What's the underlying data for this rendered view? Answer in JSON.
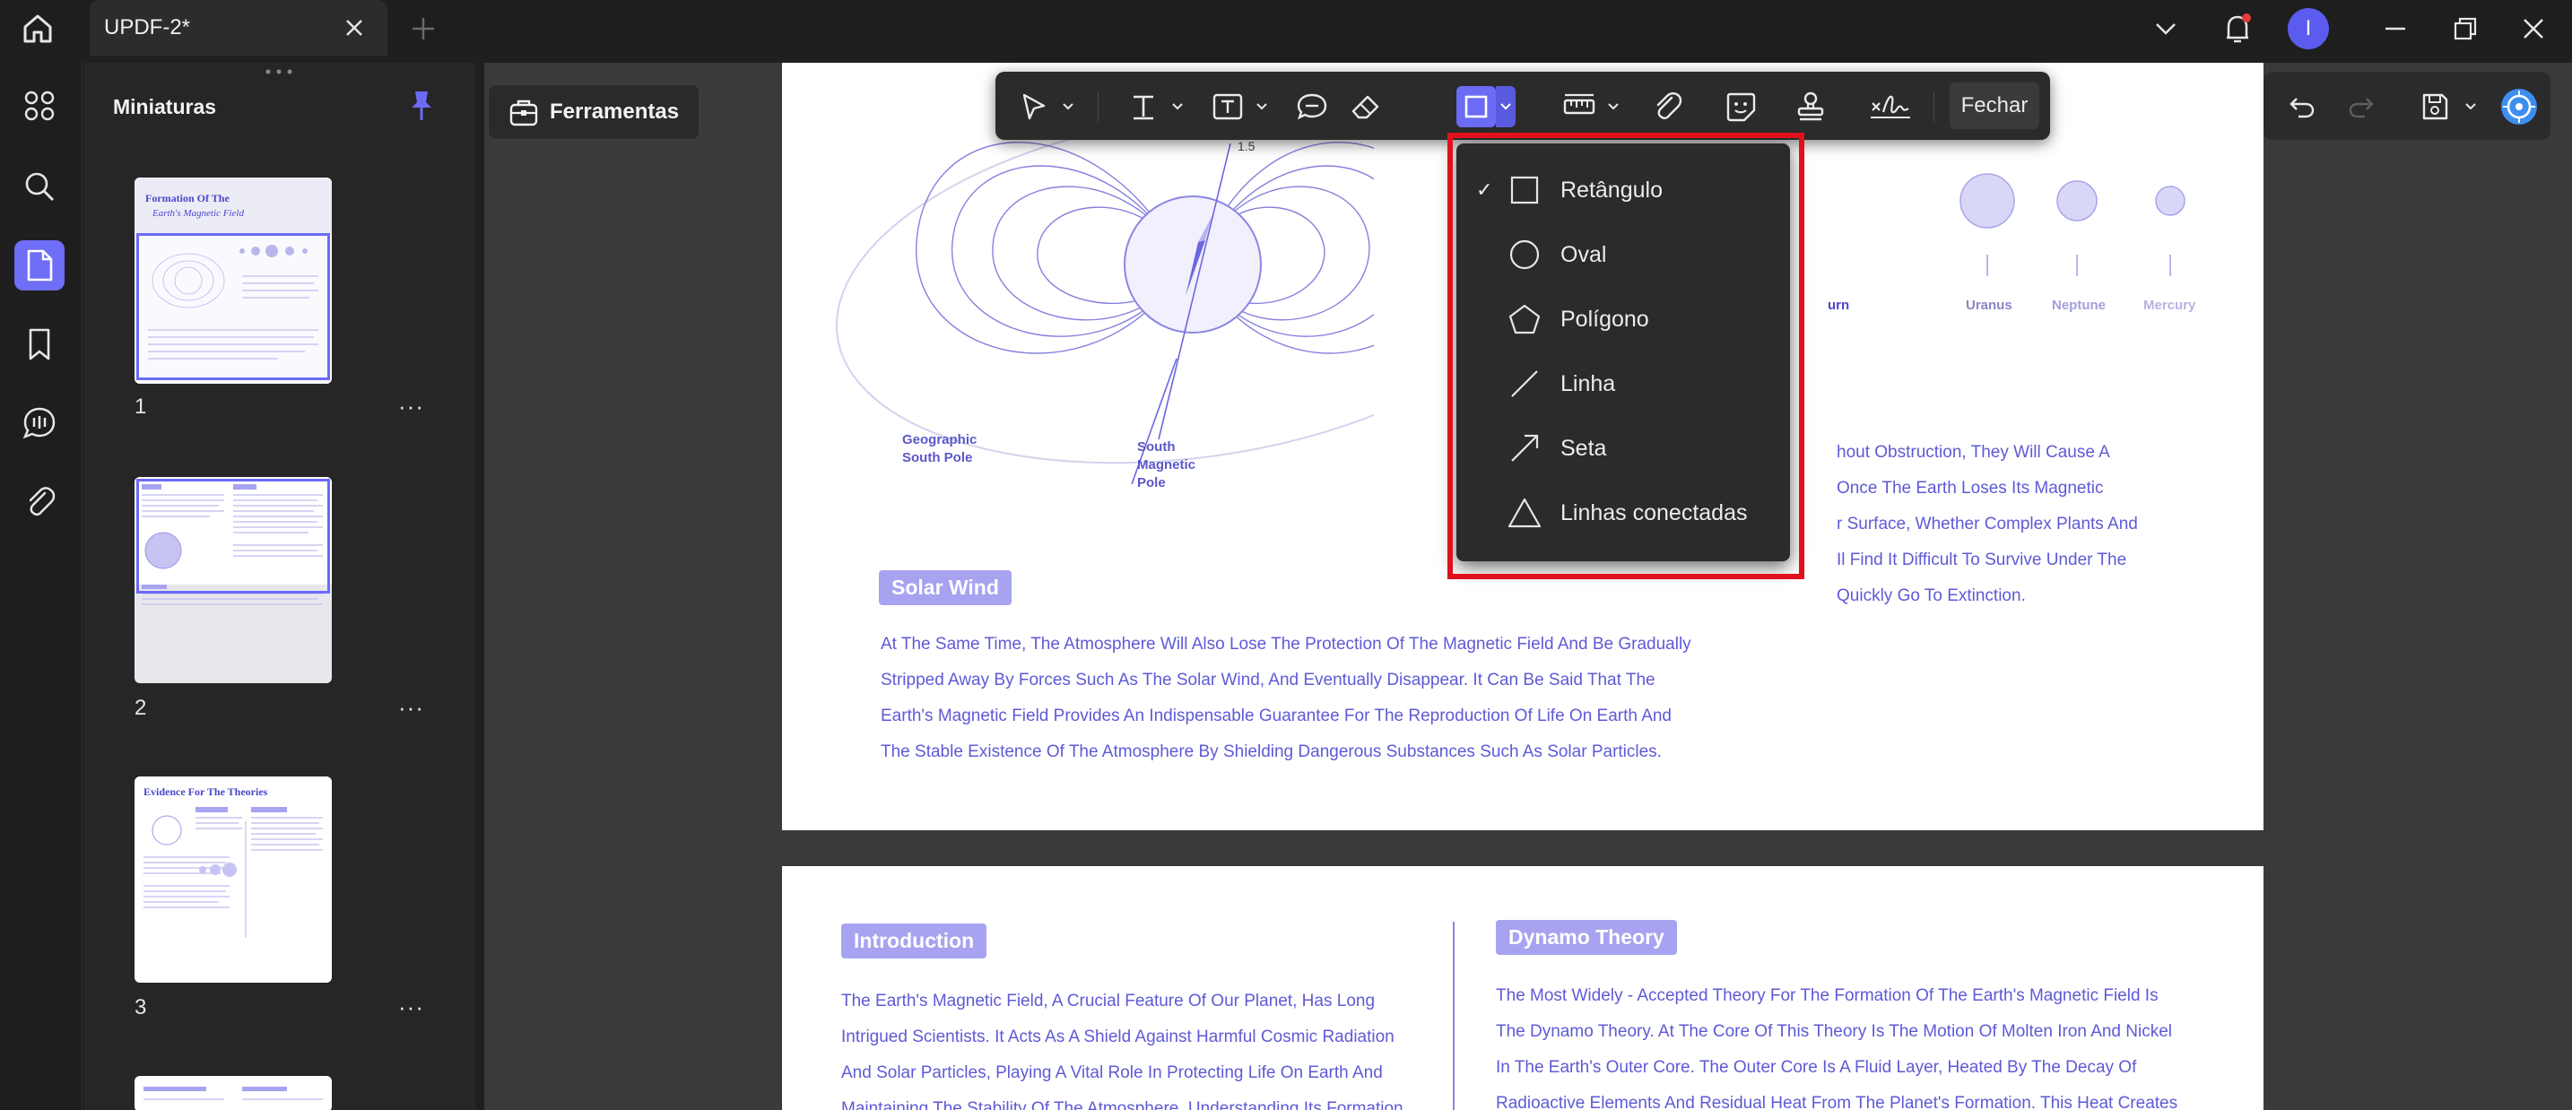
{
  "window": {
    "tab_title": "UPDF-2*"
  },
  "thumbnails": {
    "title": "Miniaturas",
    "pages": [
      {
        "number": "1",
        "more": "···",
        "title_line1": "Formation Of The",
        "title_line2": "Earth's Magnetic Field"
      },
      {
        "number": "2",
        "more": "···"
      },
      {
        "number": "3",
        "more": "···",
        "title_line1": "Evidence For The Theories"
      }
    ]
  },
  "toolbar": {
    "ferramentas_label": "Ferramentas",
    "fechar_label": "Fechar"
  },
  "dropdown": {
    "items": [
      {
        "label": "Retângulo",
        "checked": true,
        "icon": "rectangle-icon"
      },
      {
        "label": "Oval",
        "checked": false,
        "icon": "oval-icon"
      },
      {
        "label": "Polígono",
        "checked": false,
        "icon": "polygon-icon"
      },
      {
        "label": "Linha",
        "checked": false,
        "icon": "line-icon"
      },
      {
        "label": "Seta",
        "checked": false,
        "icon": "arrow-icon"
      },
      {
        "label": "Linhas conectadas",
        "checked": false,
        "icon": "connected-lines-icon"
      }
    ],
    "check_mark": "✓"
  },
  "page1": {
    "diagram": {
      "label_15": "1.5",
      "geo_south_1": "Geographic",
      "geo_south_2": "South Pole",
      "mag_south_1": "South",
      "mag_south_2": "Magnetic",
      "mag_south_3": "Pole"
    },
    "planets": [
      "urn",
      "Uranus",
      "Neptune",
      "Mercury"
    ],
    "right_text": [
      "hout Obstruction, They Will Cause A",
      "Once The Earth Loses Its Magnetic",
      "r Surface, Whether Complex Plants And",
      "Il Find It Difficult To Survive Under The",
      "Quickly Go To Extinction."
    ],
    "solar_wind_title": "Solar Wind",
    "solar_wind_text": [
      "At The Same Time, The Atmosphere Will Also Lose The Protection Of The Magnetic Field And Be Gradually",
      "Stripped Away By Forces Such As The Solar Wind, And Eventually Disappear. It Can Be Said That The",
      "Earth's Magnetic Field Provides An Indispensable Guarantee For The Reproduction Of Life On Earth And",
      "The Stable Existence Of The Atmosphere By Shielding Dangerous Substances Such As Solar Particles."
    ]
  },
  "page2": {
    "intro_title": "Introduction",
    "intro_text": [
      "The Earth's Magnetic Field, A Crucial Feature Of Our Planet, Has Long",
      "Intrigued Scientists. It Acts As A Shield Against Harmful Cosmic Radiation",
      "And Solar Particles, Playing A Vital Role In Protecting Life On Earth And",
      "Maintaining The Stability Of The Atmosphere. Understanding Its Formation"
    ],
    "dynamo_title": "Dynamo Theory",
    "dynamo_text": [
      "The Most Widely - Accepted Theory For The Formation Of The Earth's Magnetic Field Is",
      "The Dynamo Theory. At The Core Of This Theory Is The Motion Of Molten Iron And Nickel",
      "In The Earth's Outer Core. The Outer Core Is A Fluid Layer, Heated By The Decay Of",
      "Radioactive Elements And Residual Heat From The Planet's Formation. This Heat Creates"
    ]
  },
  "user": {
    "avatar_letter": "I"
  },
  "colors": {
    "accent": "#6b6bf5",
    "highlight_red": "#e1111b",
    "doc_text": "#5e5ad6"
  }
}
